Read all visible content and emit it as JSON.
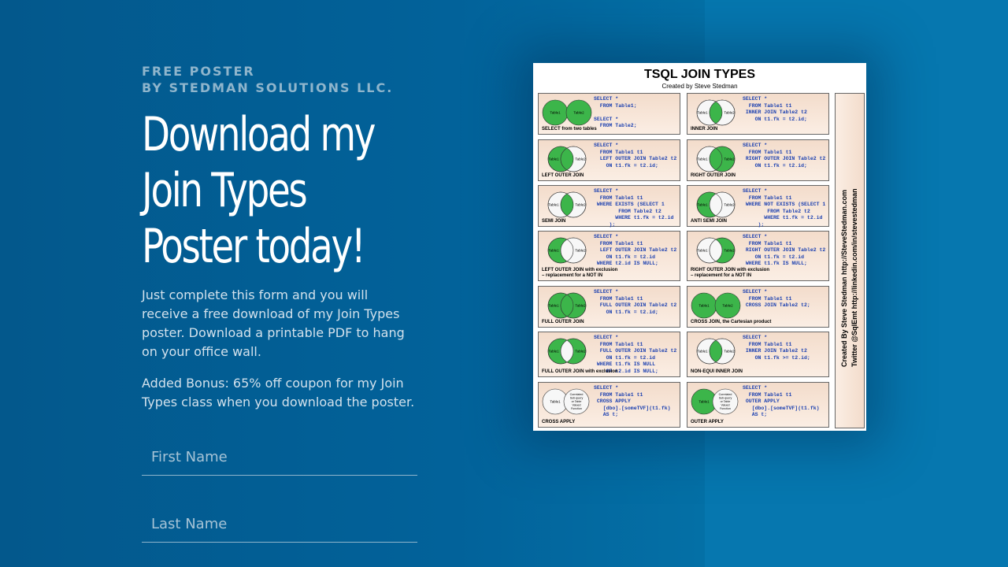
{
  "intro": {
    "eyebrow_line1": "FREE POSTER",
    "eyebrow_line2": "BY STEDMAN SOLUTIONS LLC.",
    "headline": [
      "Download my",
      "Join Types",
      "Poster today!"
    ],
    "paragraph1": "Just complete this form and you will receive a free download of my Join Types poster. Download a printable PDF to hang on your office wall.",
    "paragraph2": "Added Bonus: 65% off coupon for my Join Types class when you download the poster."
  },
  "form": {
    "first_name_placeholder": "First Name",
    "last_name_placeholder": "Last Name"
  },
  "poster": {
    "title": "TSQL JOIN TYPES",
    "subtitle": "Created by Steve Stedman",
    "side_text": [
      "Created By Steve Stedman   http://SteveStedman.com",
      "Twitter @SqlEmt   http://linkedin.com/in/stevestedman"
    ],
    "cells": [
      {
        "label": "SELECT from two tables",
        "code": "SELECT *\n  FROM Table1;\n\nSELECT *\n  FROM Table2;"
      },
      {
        "label": "INNER JOIN",
        "code": "SELECT *\n  FROM Table1 t1\n INNER JOIN Table2 t2\n    ON t1.fk = t2.id;"
      },
      {
        "label": "LEFT OUTER JOIN",
        "code": "SELECT *\n  FROM Table1 t1\n  LEFT OUTER JOIN Table2 t2\n    ON t1.fk = t2.id;"
      },
      {
        "label": "RIGHT OUTER JOIN",
        "code": "SELECT *\n  FROM Table1 t1\n RIGHT OUTER JOIN Table2 t2\n    ON t1.fk = t2.id;"
      },
      {
        "label": "SEMI JOIN",
        "code": "SELECT *\n  FROM Table1 t1\n WHERE EXISTS (SELECT 1\n        FROM Table2 t2\n       WHERE t1.fk = t2.id\n     );"
      },
      {
        "label": "ANTI SEMI JOIN",
        "code": "SELECT *\n  FROM Table1 t1\n WHERE NOT EXISTS (SELECT 1\n        FROM Table2 t2\n       WHERE t1.fk = t2.id\n     );"
      },
      {
        "label": "LEFT OUTER JOIN with exclusion\n– replacement for a NOT IN",
        "code": "SELECT *\n  FROM Table1 t1\n  LEFT OUTER JOIN Table2 t2\n    ON t1.fk = t2.id\n WHERE t2.id IS NULL;"
      },
      {
        "label": "RIGHT OUTER JOIN with exclusion\n– replacement for a NOT IN",
        "code": "SELECT *\n  FROM Table1 t1\n RIGHT OUTER JOIN Table2 t2\n    ON t1.fk = t2.id\n WHERE t1.fk IS NULL;"
      },
      {
        "label": "FULL OUTER JOIN",
        "code": "SELECT *\n  FROM Table1 t1\n  FULL OUTER JOIN Table2 t2\n    ON t1.fk = t2.id;"
      },
      {
        "label": "CROSS JOIN, the Cartesian product",
        "code": "SELECT *\n  FROM Table1 t1\n CROSS JOIN Table2 t2;"
      },
      {
        "label": "FULL OUTER JOIN with exclusion",
        "code": "SELECT *\n  FROM Table1 t1\n  FULL OUTER JOIN Table2 t2\n    ON t1.fk = t2.id\n WHERE t1.fk IS NULL\n    OR t2.id IS NULL;"
      },
      {
        "label": "NON-EQUI INNER JOIN",
        "code": "SELECT *\n  FROM Table1 t1\n INNER JOIN Table2 t2\n    ON t1.fk >= t2.id;"
      },
      {
        "label": "CROSS APPLY",
        "code": "SELECT *\n  FROM Table1 t1\n CROSS APPLY\n   [dbo].[someTVF](t1.fk)\n   AS t;"
      },
      {
        "label": "OUTER APPLY",
        "code": "SELECT *\n  FROM Table1 t1\n OUTER APPLY\n   [dbo].[someTVF](t1.fk)\n   AS t;"
      }
    ],
    "venn": {
      "table1": "Table1",
      "table2": "Table2",
      "tvf": "Correlated Sub-query or Table Valued Function"
    }
  },
  "colors": {
    "background": "#03588c",
    "accent": "#3cb54a",
    "text_muted": "#8fb5cc"
  }
}
